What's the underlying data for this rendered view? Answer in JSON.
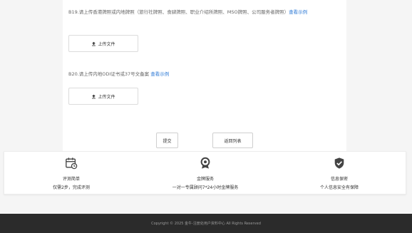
{
  "form": {
    "q19": {
      "text": "B19.请上传香港牌照或内地牌照（旅行社牌照、食肆牌照、职业介绍所牌照、MSO牌照、公司服务者牌照）",
      "link": "查看示例"
    },
    "q20": {
      "text": "B20.请上传内地ODI证书或37号文备案",
      "link": "查看示例"
    },
    "upload_label": "上传文件",
    "submit_label": "提交",
    "back_label": "返回列表"
  },
  "features": [
    {
      "icon": "calendar-clock-icon",
      "title": "评测简单",
      "desc": "仅需2步，完成评测"
    },
    {
      "icon": "medal-icon",
      "title": "金牌服务",
      "desc": "一对一专属顾问7*24小时金牌服务"
    },
    {
      "icon": "shield-check-icon",
      "title": "信息保密",
      "desc": "个人信息安全有保障"
    }
  ],
  "footer": {
    "copyright": "Copyright © 2025 金牛-注册处用户资料中心 All Rights Reserved"
  },
  "colors": {
    "link": "#2f7bd6",
    "footer_bg": "#2b2b2b",
    "icon": "#444444"
  }
}
